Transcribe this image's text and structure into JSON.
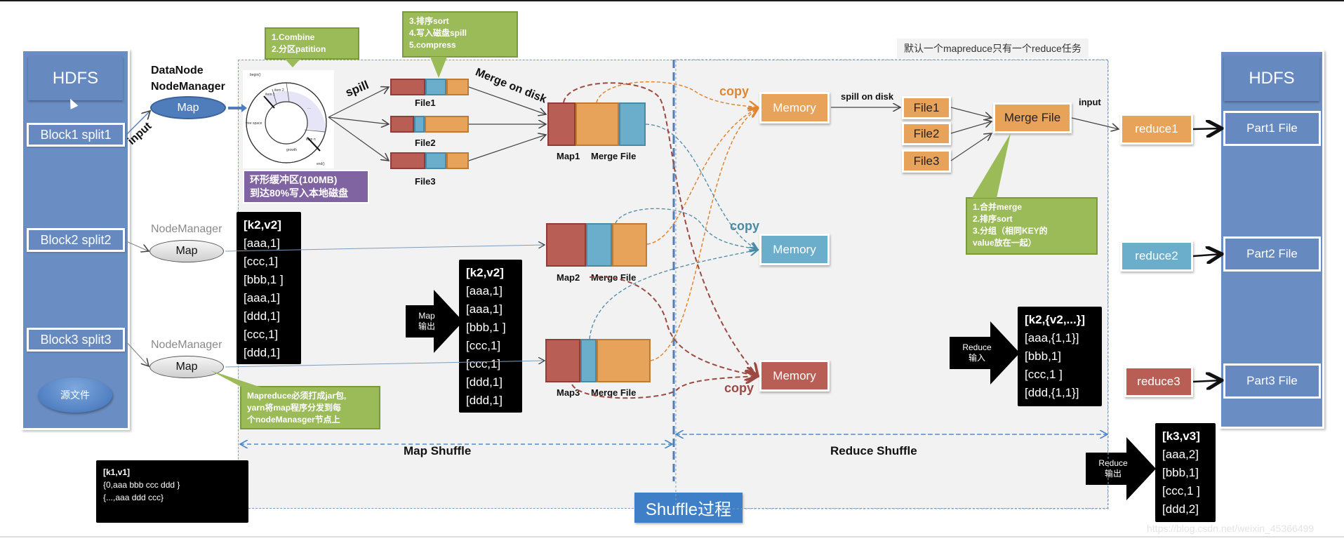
{
  "colors": {
    "hdfs_blue": "#6a8dc3",
    "red": "#b85e55",
    "blue": "#6aaecb",
    "orange": "#e8a35a",
    "green_note": "#9bbb59",
    "purple_note": "#8064a2",
    "shuffle_title": "#3f7fc7"
  },
  "hdfs_left": {
    "title": "HDFS",
    "blocks": [
      "Block1 split1",
      "Block2 split2",
      "Block3 split3"
    ],
    "source_file": "源文件"
  },
  "hdfs_right": {
    "title": "HDFS",
    "parts": [
      "Part1 File",
      "Part2 File",
      "Part3 File"
    ]
  },
  "map_side": {
    "node1_labels": [
      "DataNode",
      "NodeManager"
    ],
    "node_manager_label": "NodeManager",
    "map_label": "Map",
    "input_label": "input",
    "spill_label": "spill",
    "merge_on_disk_label": "Merge on disk",
    "ring_buffer": {
      "labels": [
        "begin()",
        "item 1",
        "item 2",
        "...",
        "item n",
        "free space",
        "growth",
        "end()"
      ],
      "note_lines": [
        "环形缓冲区(100MB)",
        "到达80%写入本地磁盘"
      ]
    },
    "note_combine": [
      "1.Combine",
      "2.分区patition"
    ],
    "note_sort": [
      "3.排序sort",
      "4.写入磁盘spill",
      "5.compress"
    ],
    "note_jar": [
      "Mapreduce必须打成jar包,",
      "yarn将map程序分发到每",
      "个nodeManasger节点上"
    ],
    "spill_files": [
      "File1",
      "File2",
      "File3"
    ],
    "merge_files": [
      {
        "map": "Map1",
        "label": "Merge File"
      },
      {
        "map": "Map2",
        "label": "Merge File"
      },
      {
        "map": "Map3",
        "label": "Merge File"
      }
    ],
    "kv_k2v2_a": {
      "header": "[k2,v2]",
      "rows": [
        "[aaa,1]",
        "[ccc,1]",
        "[bbb,1 ]",
        "[aaa,1]",
        "[ddd,1]",
        "[ccc,1]",
        "[ddd,1]"
      ]
    },
    "kv_k2v2_b": {
      "header": "[k2,v2]",
      "rows": [
        "[aaa,1]",
        "[aaa,1]",
        "[bbb,1 ]",
        "[ccc,1]",
        "[ccc,1]",
        "[ddd,1]",
        "[ddd,1]"
      ]
    },
    "map_output_tag": [
      "Map",
      "输出"
    ],
    "kv_k1v1": {
      "header": "[k1,v1]",
      "rows": [
        "{0,aaa  bbb  ccc  ddd }",
        "{...,aaa  ddd ccc}"
      ]
    }
  },
  "reduce_side": {
    "default_note": "默认一个mapreduce只有一个reduce任务",
    "copy_label": "copy",
    "memory_label": "Memory",
    "spill_on_disk_label": "spill on disk",
    "files": [
      "File1",
      "File2",
      "File3"
    ],
    "merge_file_label": "Merge File",
    "input_label": "input",
    "note_merge": [
      "1.合并merge",
      "2.排序sort",
      "3.分组（相同KEY的",
      "value放在一起）"
    ],
    "reducers": [
      "reduce1",
      "reduce2",
      "reduce3"
    ],
    "reduce_input_tag": [
      "Reduce",
      "输入"
    ],
    "kv_reduce_in": {
      "header": "[k2,{v2,...}]",
      "rows": [
        "[aaa,{1,1}]",
        "[bbb,1]",
        "[ccc,1 ]",
        "[ddd,{1,1}]"
      ]
    },
    "reduce_output_tag": [
      "Reduce",
      "输出"
    ],
    "kv_reduce_out": {
      "header": "[k3,v3]",
      "rows": [
        "[aaa,2]",
        "[bbb,1]",
        "[ccc,1 ]",
        "[ddd,2]"
      ]
    }
  },
  "sections": {
    "map_shuffle": "Map Shuffle",
    "reduce_shuffle": "Reduce Shuffle",
    "title": "Shuffle过程"
  },
  "watermark": "https://blog.csdn.net/weixin_45366499"
}
